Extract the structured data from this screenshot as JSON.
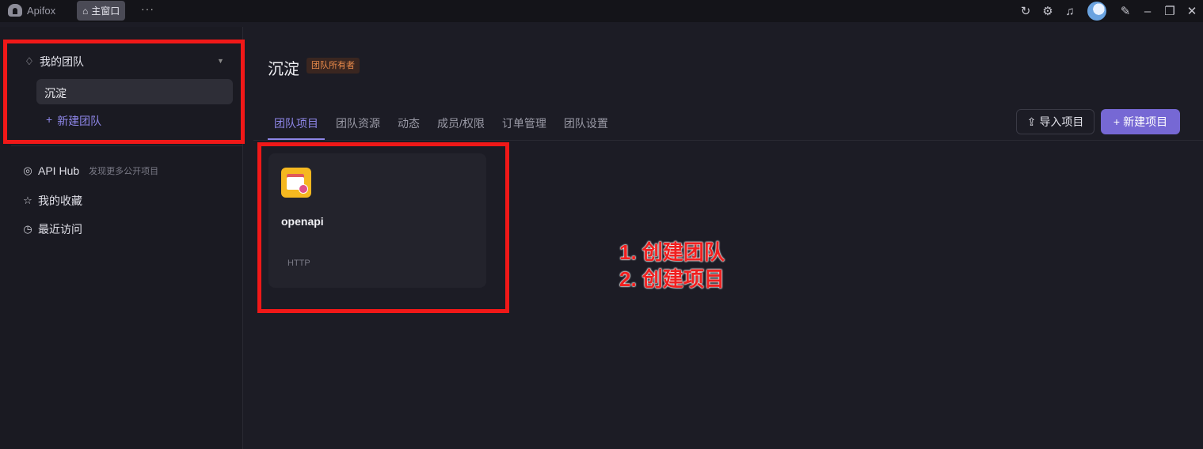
{
  "titlebar": {
    "app_name": "Apifox",
    "home_tab_label": "主窗口",
    "more_label": "···",
    "icons": [
      "refresh-icon",
      "settings-icon",
      "bell-icon",
      "avatar",
      "pin-icon",
      "minimize-icon",
      "restore-icon",
      "close-icon"
    ]
  },
  "sidebar": {
    "team_header": "我的团队",
    "teams": [
      {
        "label": "沉淀"
      }
    ],
    "new_team_label": "新建团队",
    "nav": [
      {
        "label": "API Hub",
        "sub": "发现更多公开项目",
        "icon": "compass-icon"
      },
      {
        "label": "我的收藏",
        "icon": "star-icon"
      },
      {
        "label": "最近访问",
        "icon": "clock-icon"
      }
    ]
  },
  "main": {
    "title": "沉淀",
    "owner_badge": "团队所有者",
    "tabs": [
      {
        "label": "团队项目",
        "active": true
      },
      {
        "label": "团队资源"
      },
      {
        "label": "动态"
      },
      {
        "label": "成员/权限"
      },
      {
        "label": "订单管理"
      },
      {
        "label": "团队设置"
      }
    ],
    "import_button": "导入项目",
    "new_project_button": "新建项目",
    "projects": [
      {
        "name": "openapi",
        "type": "HTTP"
      }
    ]
  },
  "annotations": {
    "line1": "1. 创建团队",
    "line2": "2. 创建项目",
    "color": "#f01818"
  },
  "colors": {
    "accent": "#7668d4",
    "background": "#1c1c25",
    "highlight": "#f01818"
  }
}
